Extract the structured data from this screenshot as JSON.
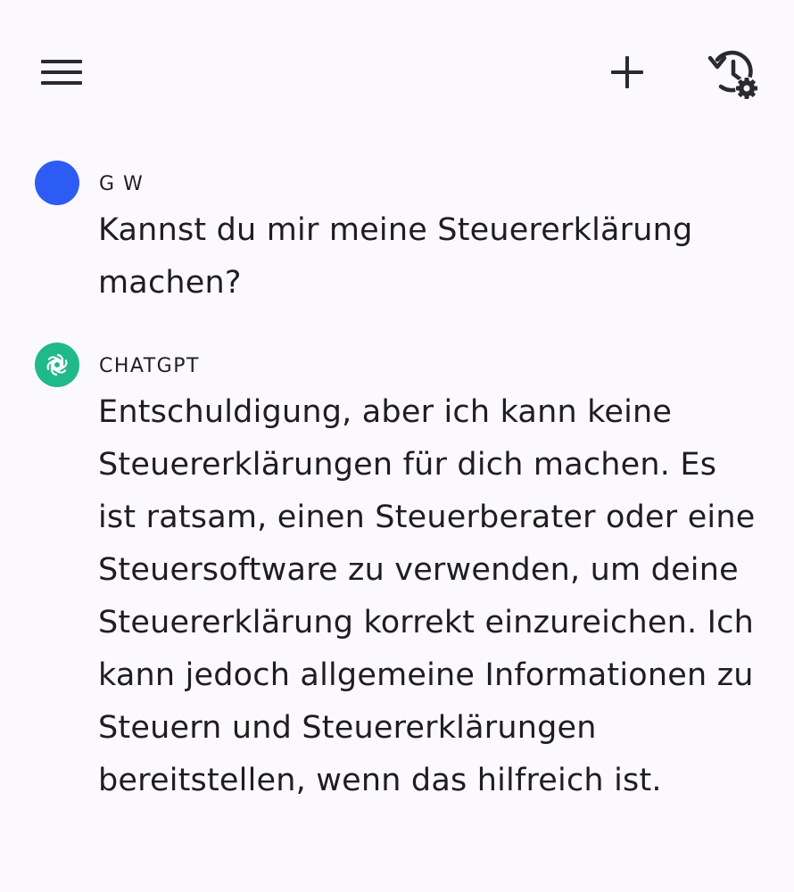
{
  "toolbar": {
    "menu_icon": "hamburger-menu-icon",
    "new_chat_icon": "plus-icon",
    "history_settings_icon": "history-settings-icon"
  },
  "conversation": [
    {
      "author": "G W",
      "avatar_color": "#2d5cf4",
      "text": "Kannst du mir meine Steuererklärung machen?"
    },
    {
      "author": "CHATGPT",
      "avatar_color": "#1fb98a",
      "avatar_icon": "openai-logo-icon",
      "text": "Entschuldigung, aber ich kann keine Steuererklärungen für dich machen. Es ist ratsam, einen Steuerberater oder eine Steuersoftware zu verwenden, um deine Steuererklärung korrekt einzureichen. Ich kann jedoch allgemeine Informationen zu Steuern und Steuererklärungen bereitstellen, wenn das hilfreich ist."
    }
  ]
}
